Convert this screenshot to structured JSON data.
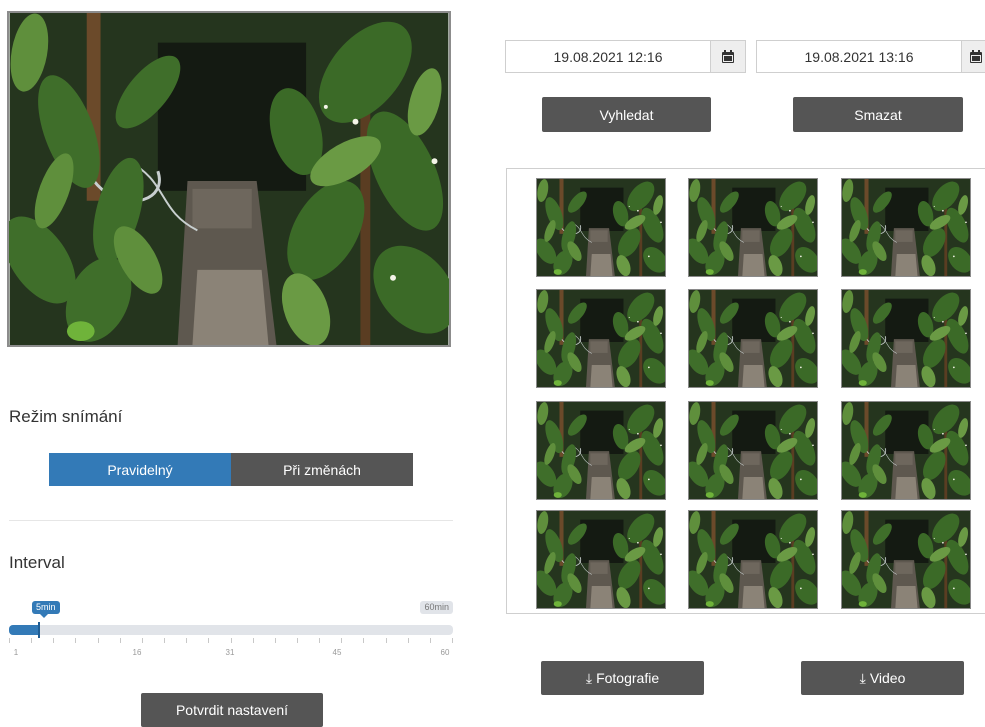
{
  "capture": {
    "mode_title": "Režim snímání",
    "mode_options": [
      "Pravidelný",
      "Při změnách"
    ],
    "selected_mode": "Pravidelný",
    "interval_title": "Interval",
    "interval_min_label": "5min",
    "interval_max_label": "60min",
    "interval_value_minutes": 5,
    "interval_range": [
      1,
      60
    ],
    "tick_labels": [
      "1",
      "16",
      "31",
      "45",
      "60"
    ],
    "confirm_label": "Potvrdit nastavení"
  },
  "search": {
    "date_from": "19.08.2021 12:16",
    "date_to": "19.08.2021 13:16",
    "search_label": "Vyhledat",
    "clear_label": "Smazat"
  },
  "gallery": {
    "thumbnail_count": 12,
    "columns": 3,
    "rows": 4
  },
  "downloads": {
    "photos_label": "Fotografie",
    "video_label": "Video"
  },
  "icons": {
    "calendar": "calendar-icon",
    "download": "download-icon"
  },
  "colors": {
    "accent": "#337ab7",
    "button": "#555555"
  }
}
